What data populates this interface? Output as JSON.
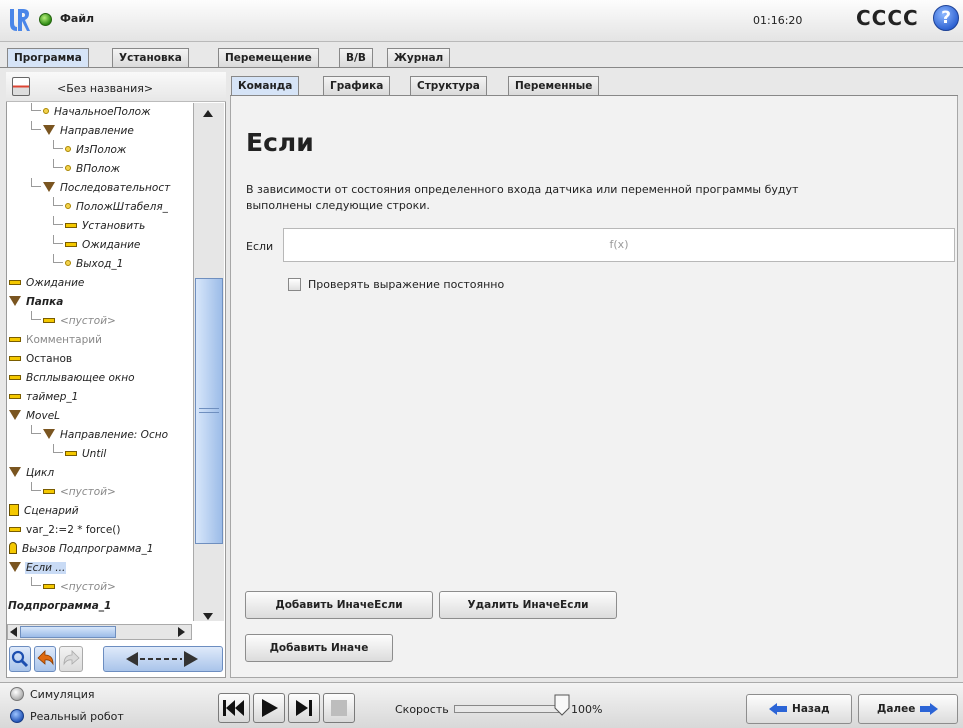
{
  "header": {
    "file_menu": "Файл",
    "clock": "01:16:20",
    "robot_name": "CCCC",
    "help": "?"
  },
  "top_tabs": [
    "Программа",
    "Установка",
    "Перемещение",
    "В/В",
    "Журнал"
  ],
  "program": {
    "name": "<Без названия>"
  },
  "tree": [
    {
      "indent": 1,
      "icon": "dot",
      "label": "НачальноеПолож",
      "style": "it"
    },
    {
      "indent": 1,
      "icon": "tri",
      "label": "Направление",
      "style": "it"
    },
    {
      "indent": 2,
      "icon": "dot",
      "label": "ИзПолож",
      "style": "it"
    },
    {
      "indent": 2,
      "icon": "dot",
      "label": "ВПолож",
      "style": "it"
    },
    {
      "indent": 1,
      "icon": "tri",
      "label": "Последовательност",
      "style": "it"
    },
    {
      "indent": 2,
      "icon": "dot",
      "label": "ПоложШтабеля_",
      "style": "it"
    },
    {
      "indent": 2,
      "icon": "bar",
      "label": "Установить",
      "style": "it"
    },
    {
      "indent": 2,
      "icon": "bar",
      "label": "Ожидание",
      "style": "it"
    },
    {
      "indent": 2,
      "icon": "dot",
      "label": "Выход_1",
      "style": "it"
    },
    {
      "indent": 0,
      "icon": "bar",
      "label": "Ожидание",
      "style": "it"
    },
    {
      "indent": 0,
      "icon": "tri",
      "label": "Папка",
      "style": "it bd"
    },
    {
      "indent": 1,
      "icon": "bar",
      "label": "<пустой>",
      "style": "it gray"
    },
    {
      "indent": 0,
      "icon": "bar",
      "label": "Комментарий",
      "style": "gray"
    },
    {
      "indent": 0,
      "icon": "bar",
      "label": "Останов",
      "style": ""
    },
    {
      "indent": 0,
      "icon": "bar",
      "label": "Всплывающее окно",
      "style": "it"
    },
    {
      "indent": 0,
      "icon": "bar",
      "label": "таймер_1",
      "style": "it"
    },
    {
      "indent": 0,
      "icon": "tri",
      "label": "MoveL",
      "style": "it"
    },
    {
      "indent": 1,
      "icon": "tri",
      "label": "Направление: Осно",
      "style": "it"
    },
    {
      "indent": 2,
      "icon": "bar",
      "label": "Until",
      "style": "it"
    },
    {
      "indent": 0,
      "icon": "tri",
      "label": "Цикл",
      "style": "it"
    },
    {
      "indent": 1,
      "icon": "bar",
      "label": "<пустой>",
      "style": "it gray"
    },
    {
      "indent": 0,
      "icon": "script",
      "label": "Сценарий",
      "style": "it"
    },
    {
      "indent": 0,
      "icon": "bar",
      "label": "var_2:=2 * force()",
      "style": ""
    },
    {
      "indent": 0,
      "icon": "call",
      "label": "Вызов Подпрограмма_1",
      "style": "it"
    },
    {
      "indent": 0,
      "icon": "tri",
      "label": "Если ...",
      "style": "it",
      "selected": true
    },
    {
      "indent": 1,
      "icon": "bar",
      "label": "<пустой>",
      "style": "it gray"
    },
    {
      "indent": -1,
      "icon": "none",
      "label": "Подпрограмма_1",
      "style": "it bd"
    }
  ],
  "sub_tabs": [
    "Команда",
    "Графика",
    "Структура",
    "Переменные"
  ],
  "main": {
    "title": "Если",
    "description_line1": "В зависимости от состояния определенного входа датчика или переменной программы будут",
    "description_line2": "выполнены следующие строки.",
    "if_label": "Если",
    "expression_placeholder": "f(x)",
    "check_label": "Проверять выражение постоянно",
    "add_elseif": "Добавить ИначеЕсли",
    "del_elseif": "Удалить ИначеЕсли",
    "add_else": "Добавить Иначе"
  },
  "footer": {
    "simulation": "Симуляция",
    "real_robot": "Реальный робот",
    "speed_label": "Скорость",
    "speed_value": "100%",
    "speed_fraction": 1.0,
    "back": "Назад",
    "next": "Далее"
  },
  "colors": {
    "accent": "#2b5fd0",
    "selection": "#c9dbf5",
    "tab_active": "#d6e4f7"
  }
}
